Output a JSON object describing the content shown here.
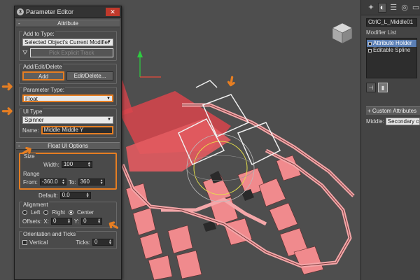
{
  "dialog": {
    "title": "Parameter Editor",
    "close_glyph": "✕",
    "attribute_rollout": "Attribute",
    "add_to_type_label": "Add to Type:",
    "add_to_type_value": "Selected Object's Current Modifier",
    "pick_explicit_track": "Pick Explicit Track",
    "add_edit_delete_label": "Add/Edit/Delete",
    "add_button": "Add",
    "edit_delete_button": "Edit/Delete...",
    "parameter_type_label": "Parameter Type:",
    "parameter_type_value": "Float",
    "ui_type_label": "UI Type",
    "ui_type_value": "Spinner",
    "name_label": "Name:",
    "name_value": "Middle Middle Y",
    "float_ui_rollout": "Float UI Options",
    "size_label": "Size",
    "width_label": "Width:",
    "width_value": "100",
    "range_label": "Range",
    "from_label": "From:",
    "from_value": "-360.0",
    "to_label": "To:",
    "to_value": "360",
    "default_label": "Default:",
    "default_value": "0.0",
    "alignment_label": "Alignment",
    "left_label": "Left",
    "right_label": "Right",
    "center_label": "Center",
    "alignment_selected": "Center",
    "offsets_label": "Offsets:",
    "offset_x_label": "X:",
    "offset_x_value": "0",
    "offset_y_label": "Y:",
    "offset_y_value": "0",
    "orientation_label": "Orientation and Ticks",
    "vertical_label": "Vertical",
    "ticks_label": "Ticks:",
    "ticks_value": "0"
  },
  "command_panel": {
    "object_name": "CtrlC_L_Middle01",
    "modifier_list_label": "Modifier List",
    "stack": [
      {
        "label": "Attribute Holder",
        "selected": true
      },
      {
        "label": "Editable Spline",
        "selected": false
      }
    ],
    "custom_attributes_rollout": "Custom Attributes",
    "middle_label": "Middle:",
    "middle_value": "Secondary cont"
  },
  "colors": {
    "highlight": "#e67e22",
    "selection": "#5b7fb5",
    "mesh": "#e8696e"
  },
  "icons": [
    "close-icon",
    "pin-icon",
    "create-icon",
    "modify-icon",
    "hierarchy-icon",
    "motion-icon",
    "display-icon",
    "utilities-icon",
    "viewcube-icon",
    "dropdown-arrow-icon",
    "spinner-icon",
    "orange-arrow-icon"
  ]
}
